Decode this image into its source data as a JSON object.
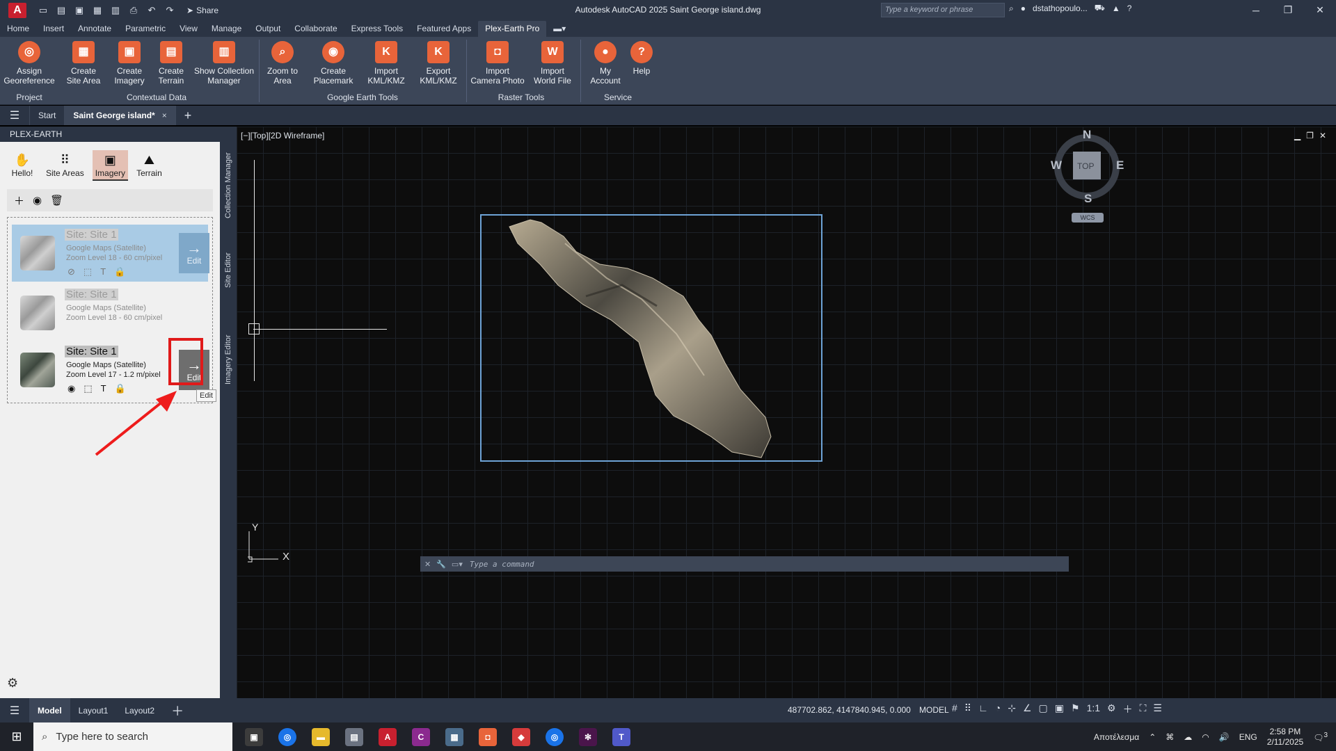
{
  "titlebar": {
    "app_logo": "A",
    "share_label": "Share",
    "title": "Autodesk AutoCAD 2025   Saint George island.dwg",
    "search_placeholder": "Type a keyword or phrase",
    "user": "dstathopoulo...",
    "qat_icons": [
      "new-icon",
      "open-icon",
      "save-icon",
      "saveas-icon",
      "web-open-icon",
      "plot-icon",
      "undo-icon",
      "redo-icon"
    ]
  },
  "ribbon_tabs": [
    "Home",
    "Insert",
    "Annotate",
    "Parametric",
    "View",
    "Manage",
    "Output",
    "Collaborate",
    "Express Tools",
    "Featured Apps",
    "Plex-Earth Pro"
  ],
  "ribbon": {
    "buttons": [
      {
        "label": "Assign\nGeoreference"
      },
      {
        "label": "Create\nSite Area"
      },
      {
        "label": "Create\nImagery"
      },
      {
        "label": "Create\nTerrain"
      },
      {
        "label": "Show Collection\nManager"
      },
      {
        "label": "Zoom to\nArea"
      },
      {
        "label": "Create\nPlacemark"
      },
      {
        "label": "Import\nKML/KMZ"
      },
      {
        "label": "Export\nKML/KMZ"
      },
      {
        "label": "Import\nCamera Photo"
      },
      {
        "label": "Import\nWorld File"
      },
      {
        "label": "My\nAccount"
      },
      {
        "label": "Help"
      }
    ],
    "groups": [
      "Project",
      "Contextual Data",
      "Google Earth Tools",
      "Raster Tools",
      "Service"
    ]
  },
  "doc_tabs": {
    "start": "Start",
    "active": "Saint George island*",
    "close": "×",
    "add": "+"
  },
  "palette": {
    "title": "PLEX-EARTH",
    "tabs": [
      "Hello!",
      "Site Areas",
      "Imagery",
      "Terrain"
    ],
    "items": [
      {
        "title": "Site: Site 1",
        "source": "Google Maps (Satellite)",
        "zoom": "Zoom Level 18 - 60 cm/pixel",
        "edit": "Edit"
      },
      {
        "title": "Site: Site 1",
        "source": "Google Maps (Satellite)",
        "zoom": "Zoom Level 18 - 60 cm/pixel"
      },
      {
        "title": "Site: Site 1",
        "source": "Google Maps (Satellite)",
        "zoom": "Zoom Level 17 - 1.2 m/pixel",
        "edit": "Edit"
      }
    ],
    "tooltip": "Edit"
  },
  "side_tabs": [
    "Collection Manager",
    "Site Editor",
    "Imagery Editor"
  ],
  "viewport": {
    "label": "[−][Top][2D Wireframe]",
    "compass": {
      "n": "N",
      "s": "S",
      "e": "E",
      "w": "W",
      "top": "TOP"
    },
    "wcs": "WCS",
    "ucs_x": "X",
    "ucs_y": "Y",
    "command_placeholder": "Type a command"
  },
  "status": {
    "layout_tabs": [
      "Model",
      "Layout1",
      "Layout2"
    ],
    "coords": "487702.862, 4147840.945, 0.000",
    "mode": "MODEL",
    "scale": "1:1"
  },
  "taskbar": {
    "search_placeholder": "Type here to search",
    "tray_text": "Αποτέλεσμα",
    "lang": "ENG",
    "time": "2:58 PM",
    "date": "2/11/2025",
    "notifications": "3"
  },
  "colors": {
    "accent": "#e8643a",
    "highlight": "#e01a1a",
    "selection": "#a9cbe5",
    "boundary": "#6ea3d6"
  }
}
